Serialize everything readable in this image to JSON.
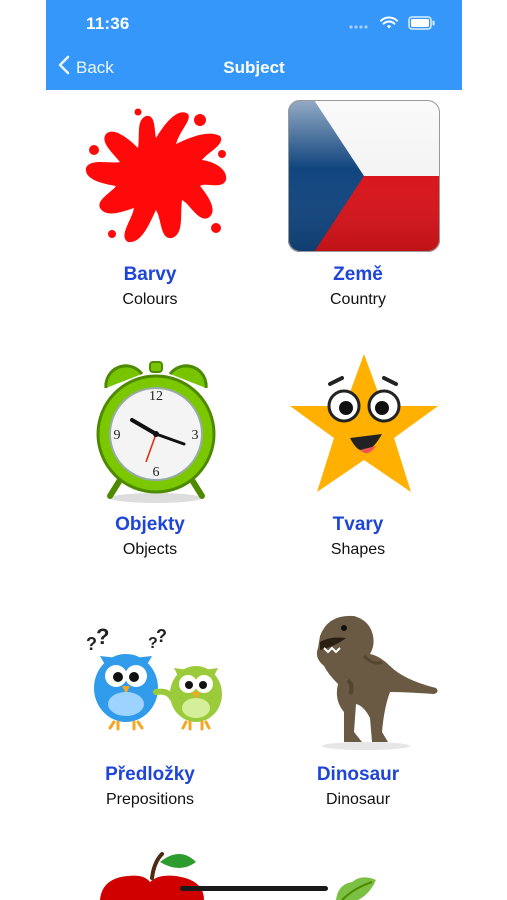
{
  "status": {
    "time": "11:36"
  },
  "nav": {
    "back_label": "Back",
    "title": "Subject"
  },
  "tiles": [
    {
      "title": "Barvy",
      "subtitle": "Colours",
      "icon": "paint-splash-icon"
    },
    {
      "title": "Země",
      "subtitle": "Country",
      "icon": "czech-flag-icon"
    },
    {
      "title": "Objekty",
      "subtitle": "Objects",
      "icon": "alarm-clock-icon"
    },
    {
      "title": "Tvary",
      "subtitle": "Shapes",
      "icon": "star-icon"
    },
    {
      "title": "Předložky",
      "subtitle": "Prepositions",
      "icon": "owls-icon"
    },
    {
      "title": "Dinosaur",
      "subtitle": "Dinosaur",
      "icon": "dinosaur-icon"
    }
  ],
  "colors": {
    "nav_bar": "#3497F9",
    "title_text": "#1F45D8",
    "subtitle_text": "#111111"
  }
}
